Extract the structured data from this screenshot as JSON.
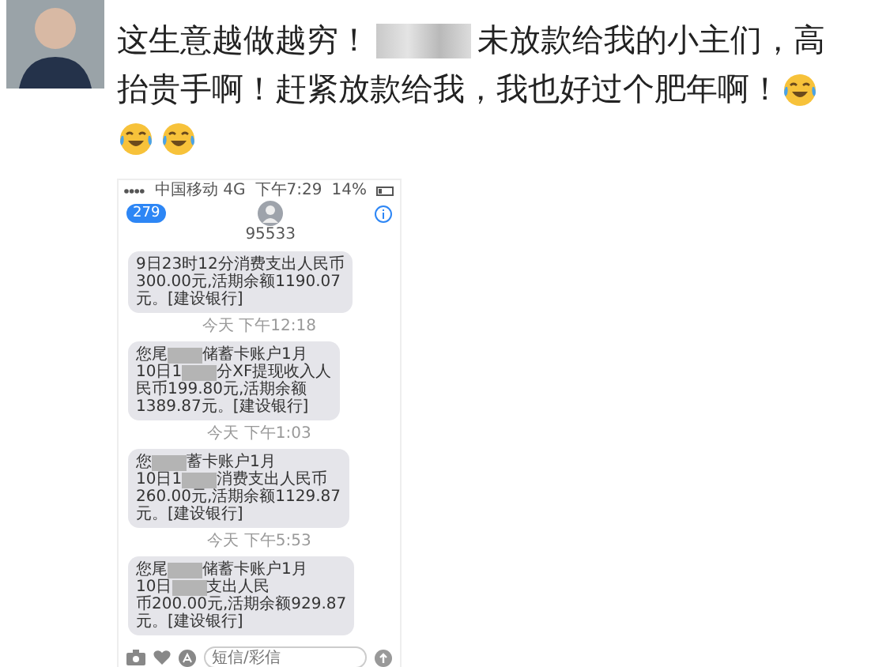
{
  "post": {
    "lines": [
      [
        {
          "kind": "text",
          "value": "这生意越做越穷！"
        },
        {
          "kind": "redacted"
        },
        {
          "kind": "text",
          "value": "未放款给我的小主们，高"
        }
      ],
      [
        {
          "kind": "text",
          "value": "抬贵手啊！赶紧放款给我，我也好过个肥年啊！"
        },
        {
          "kind": "emoji"
        }
      ],
      [
        {
          "kind": "emoji"
        },
        {
          "kind": "emoji"
        }
      ]
    ]
  },
  "phone": {
    "status_bar": {
      "carrier": "中国移动 4G",
      "time": "下午7:29",
      "battery": "14%"
    },
    "nav": {
      "back_count": "279",
      "contact": "95533"
    },
    "thread": [
      {
        "kind": "bubble",
        "lines": [
          [
            {
              "kind": "text",
              "value": "9日23时12分消费支出人民币"
            }
          ],
          [
            {
              "kind": "text",
              "value": "300.00元,活期余额1190.07"
            }
          ],
          [
            {
              "kind": "text",
              "value": "元。[建设银行]"
            }
          ]
        ]
      },
      {
        "kind": "timestamp",
        "text": "今天 下午12:18"
      },
      {
        "kind": "bubble",
        "lines": [
          [
            {
              "kind": "text",
              "value": "您尾"
            },
            {
              "kind": "redacted"
            },
            {
              "kind": "text",
              "value": "储蓄卡账户1月"
            }
          ],
          [
            {
              "kind": "text",
              "value": "10日1"
            },
            {
              "kind": "redacted"
            },
            {
              "kind": "text",
              "value": "分XF提现收入人"
            }
          ],
          [
            {
              "kind": "text",
              "value": "民币199.80元,活期余额"
            }
          ],
          [
            {
              "kind": "text",
              "value": "1389.87元。[建设银行]"
            }
          ]
        ]
      },
      {
        "kind": "timestamp",
        "text": "今天 下午1:03"
      },
      {
        "kind": "bubble",
        "lines": [
          [
            {
              "kind": "text",
              "value": "您"
            },
            {
              "kind": "redacted"
            },
            {
              "kind": "text",
              "value": "蓄卡账户1月"
            }
          ],
          [
            {
              "kind": "text",
              "value": "10日1"
            },
            {
              "kind": "redacted"
            },
            {
              "kind": "text",
              "value": "消费支出人民币"
            }
          ],
          [
            {
              "kind": "text",
              "value": "260.00元,活期余额1129.87"
            }
          ],
          [
            {
              "kind": "text",
              "value": "元。[建设银行]"
            }
          ]
        ]
      },
      {
        "kind": "timestamp",
        "text": "今天 下午5:53"
      },
      {
        "kind": "bubble",
        "lines": [
          [
            {
              "kind": "text",
              "value": "您尾"
            },
            {
              "kind": "redacted"
            },
            {
              "kind": "text",
              "value": "储蓄卡账户1月"
            }
          ],
          [
            {
              "kind": "text",
              "value": "10日"
            },
            {
              "kind": "redacted"
            },
            {
              "kind": "text",
              "value": "支出人民"
            }
          ],
          [
            {
              "kind": "text",
              "value": "币200.00元,活期余额929.87"
            }
          ],
          [
            {
              "kind": "text",
              "value": "元。[建设银行]"
            }
          ]
        ]
      }
    ],
    "composer": {
      "placeholder": "短信/彩信"
    }
  }
}
